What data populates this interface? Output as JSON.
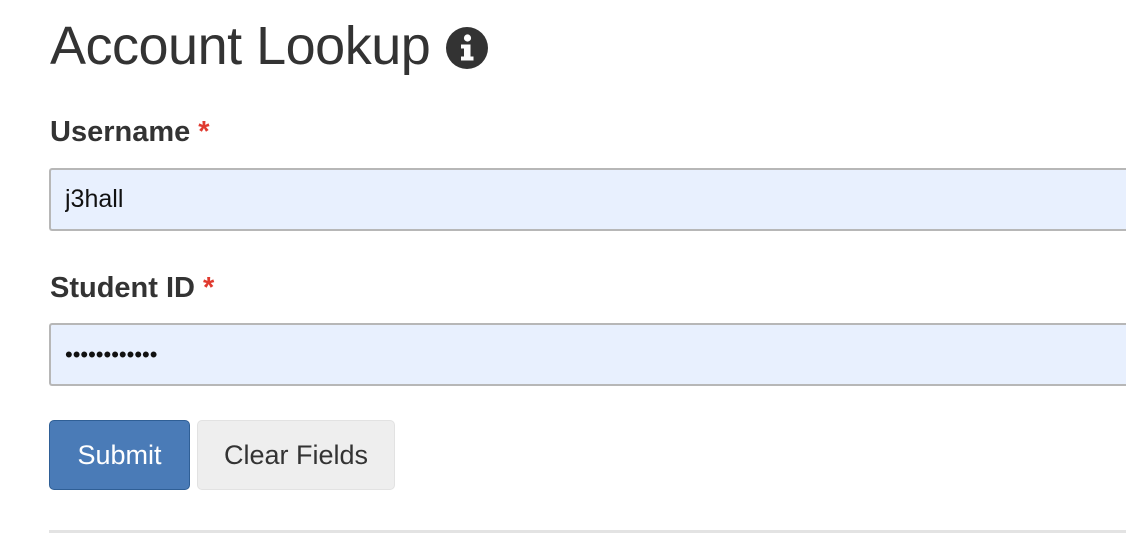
{
  "header": {
    "title": "Account Lookup",
    "info_icon": "info-circle-icon"
  },
  "form": {
    "username": {
      "label": "Username",
      "required_marker": "*",
      "value": "j3hall"
    },
    "student_id": {
      "label": "Student ID",
      "required_marker": "*",
      "value": "••••••••••••"
    },
    "submit_label": "Submit",
    "clear_label": "Clear Fields"
  },
  "colors": {
    "input_background": "#e8f0fe",
    "primary_button": "#4a7bb7",
    "required_marker": "#e03a2f",
    "secondary_button": "#eeeeee"
  }
}
